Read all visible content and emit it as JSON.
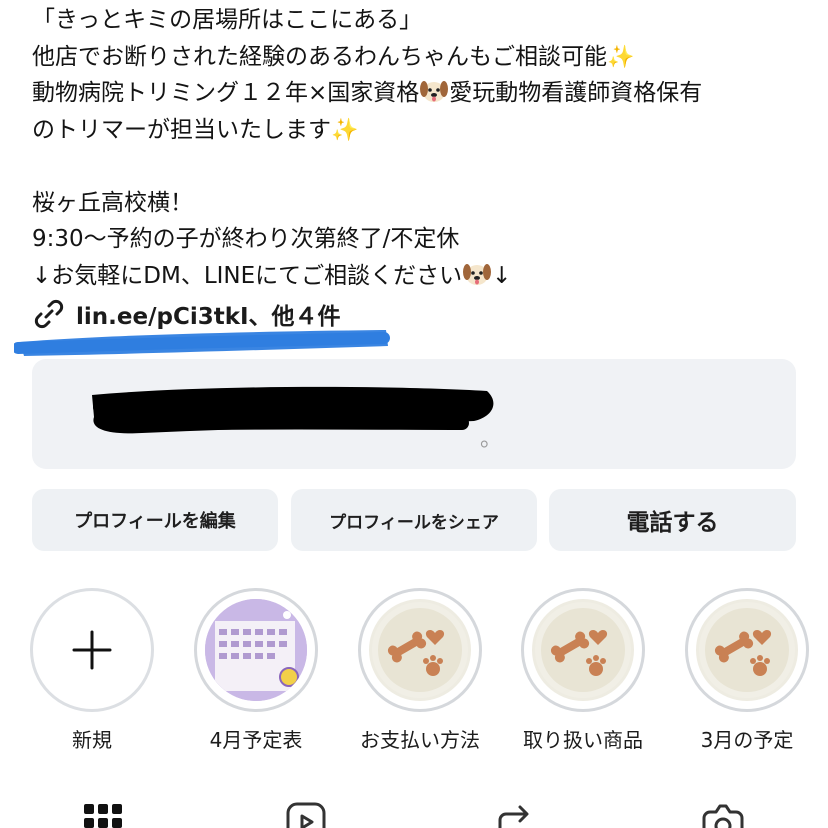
{
  "bio": {
    "line1": "「きっとキミの居場所はここにある」",
    "line2": "他店でお断りされた経験のあるわんちゃんもご相談可能",
    "line3a": "動物病院トリミング１２年×国家資格",
    "line3b": "愛玩動物看護師資格保有",
    "line4": "のトリマーが担当いたします",
    "line5": "桜ヶ丘高校横！",
    "line6": "9:30〜予約の子が終わり次第終了/不定休",
    "line7": "↓お気軽にDM、LINEにてご相談ください",
    "line7_end": "↓",
    "sparkle": "✨"
  },
  "link": {
    "text": "lin.ee/pCi3tkI、他４件"
  },
  "message_card": {
    "visible_tail": "。"
  },
  "buttons": {
    "edit_profile": "プロフィールを編集",
    "share_profile": "プロフィールをシェア",
    "call": "電話する"
  },
  "highlights": [
    {
      "label": "新規"
    },
    {
      "label": "4月予定表"
    },
    {
      "label": "お支払い方法"
    },
    {
      "label": "取り扱い商品"
    },
    {
      "label": "3月の予定"
    }
  ],
  "colors": {
    "button_bg": "#eef1f4",
    "blue_scribble": "#2f7ee0",
    "redaction": "#000000"
  },
  "icons": [
    "link-icon",
    "plus-icon",
    "grid-icon",
    "reels-icon",
    "repost-icon",
    "tagged-icon"
  ]
}
